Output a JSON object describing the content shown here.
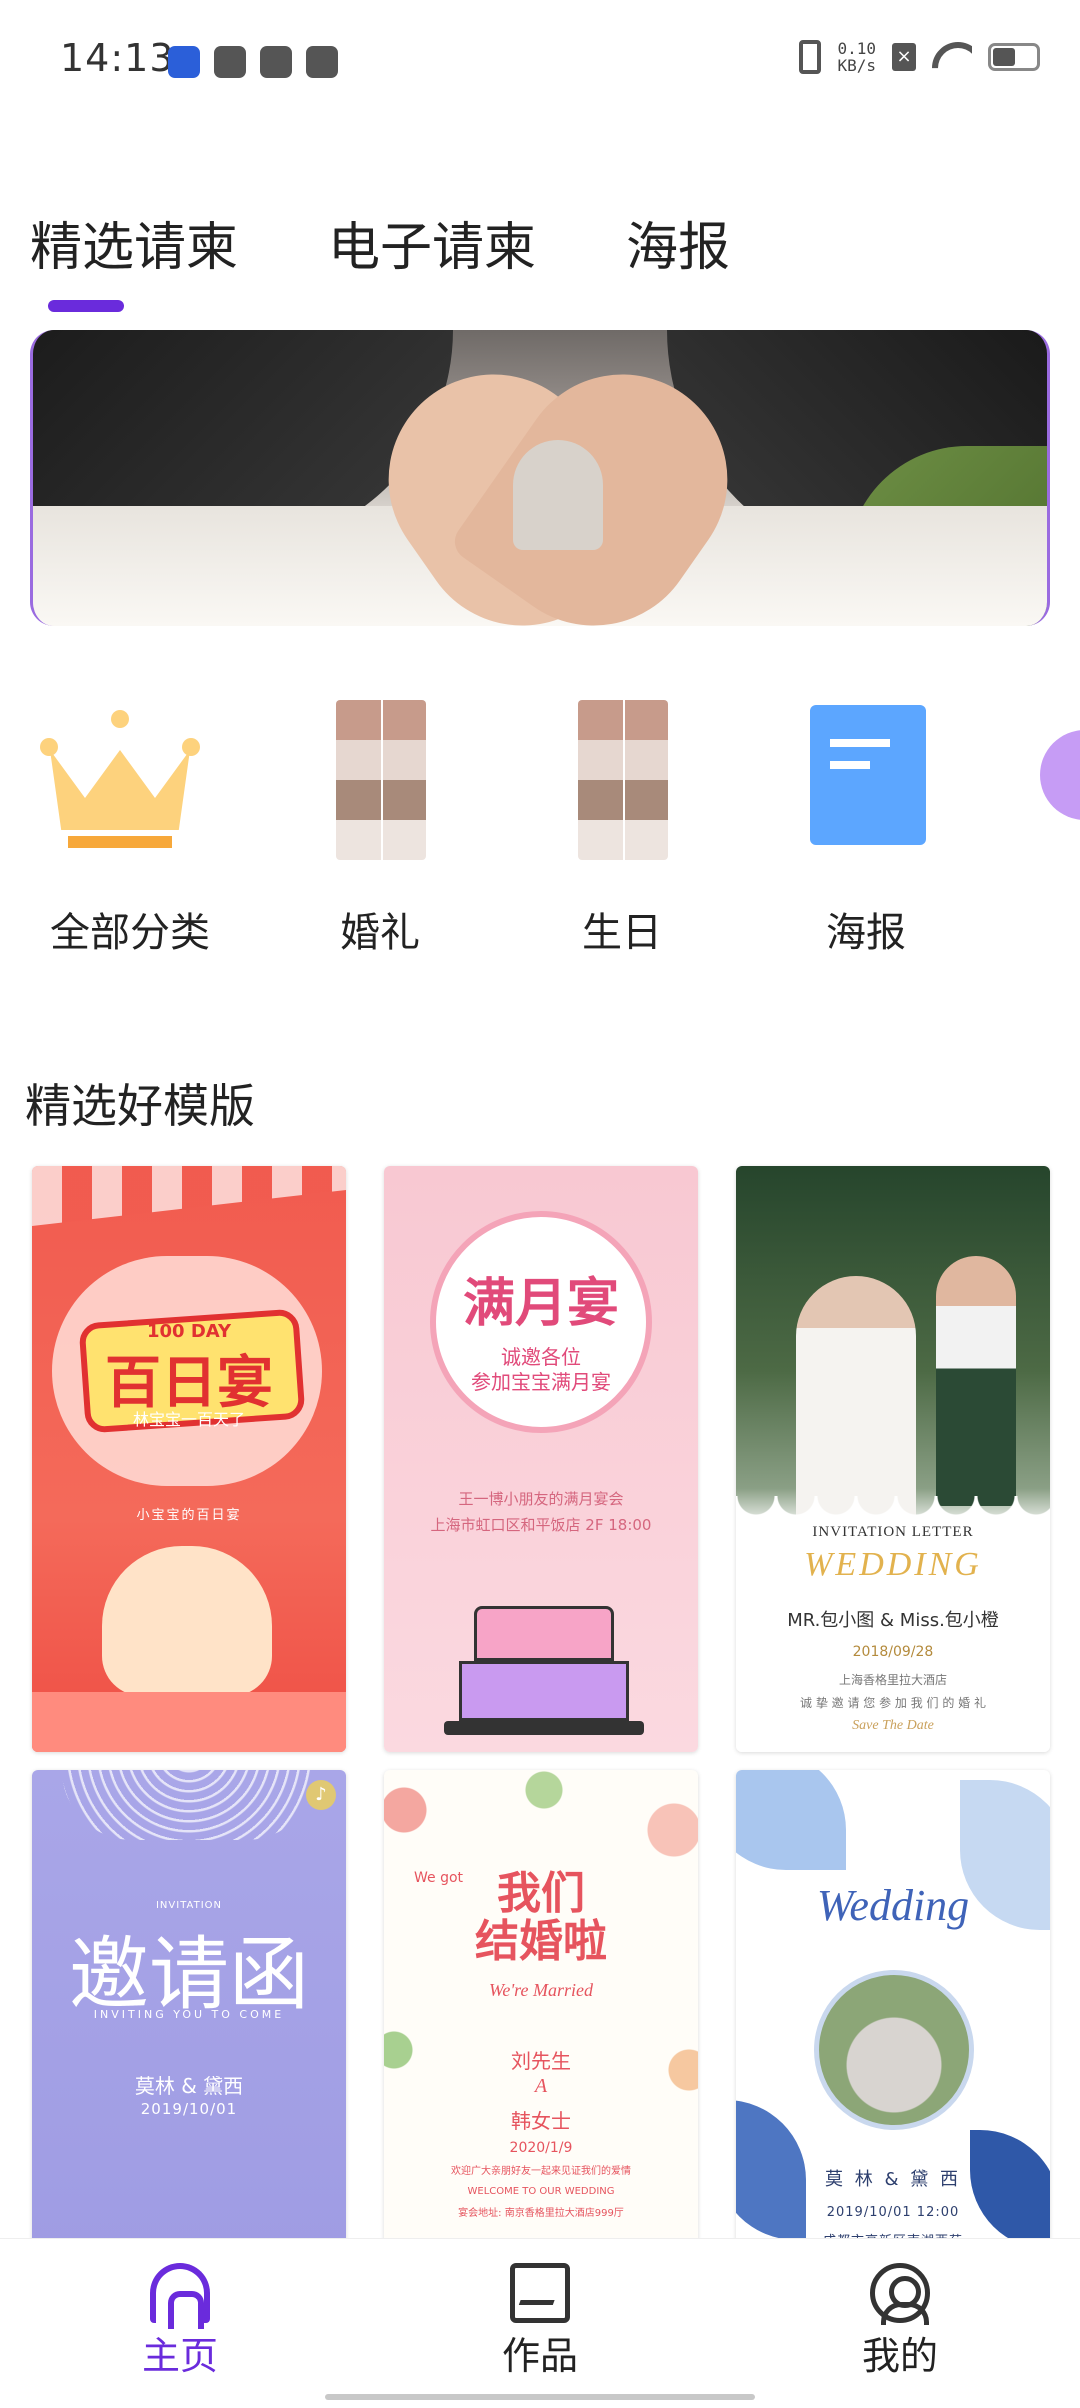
{
  "status_bar": {
    "time": "14:13",
    "net_speed_value": "0.10",
    "net_speed_unit": "KB/s"
  },
  "tabs": [
    {
      "label": "精选请柬",
      "active": true
    },
    {
      "label": "电子请柬",
      "active": false
    },
    {
      "label": "海报",
      "active": false
    }
  ],
  "colors": {
    "accent": "#6a2bdc"
  },
  "categories": [
    {
      "label": "全部分类",
      "icon": "crown-icon"
    },
    {
      "label": "婚礼",
      "icon": "photo-thumbnail"
    },
    {
      "label": "生日",
      "icon": "photo-thumbnail"
    },
    {
      "label": "海报",
      "icon": "document-icon"
    },
    {
      "label": "",
      "icon": "purple-circle-icon"
    }
  ],
  "section": {
    "title": "精选好模版"
  },
  "templates": {
    "t1": {
      "badge": "100 DAY",
      "title": "百日宴",
      "subtitle": "林宝宝一百天了",
      "line": "小宝宝的百日宴"
    },
    "t2": {
      "title": "满月宴",
      "subtitle1": "诚邀各位",
      "subtitle2": "参加宝宝满月宴",
      "info1": "王一博小朋友的满月宴会",
      "info2": "上海市虹口区和平饭店 2F 18:00"
    },
    "t3": {
      "label": "INVITATION LETTER",
      "title": "WEDDING",
      "names": "MR.包小图 & Miss.包小橙",
      "date": "2018/09/28",
      "venue": "上海香格里拉大酒店",
      "line": "诚 挚 邀 请 您 参 加 我 们 的 婚 礼",
      "footer": "Save The Date"
    },
    "t4": {
      "label": "INVITATION",
      "title": "邀请函",
      "sub": "INVITING YOU TO COME",
      "names": "莫林 & 黛西",
      "date": "2019/10/01"
    },
    "t5": {
      "title1": "我们",
      "title2": "结婚啦",
      "we_got": "We got",
      "married": "We're Married",
      "groom": "刘先生",
      "amp": "A",
      "bride": "韩女士",
      "date": "2020/1/9",
      "line1": "欢迎广大亲朋好友一起来见证我们的爱情",
      "line2": "WELCOME TO OUR WEDDING",
      "line3": "宴会地址: 南京香格里拉大酒店999厅"
    },
    "t6": {
      "title": "Wedding",
      "names": "莫 林 & 黛 西",
      "date": "2019/10/01 12:00",
      "venue": "成都市高新区南湖西苑"
    }
  },
  "bottom_nav": [
    {
      "label": "主页",
      "icon": "home-icon",
      "active": true
    },
    {
      "label": "作品",
      "icon": "works-icon",
      "active": false
    },
    {
      "label": "我的",
      "icon": "profile-icon",
      "active": false
    }
  ]
}
